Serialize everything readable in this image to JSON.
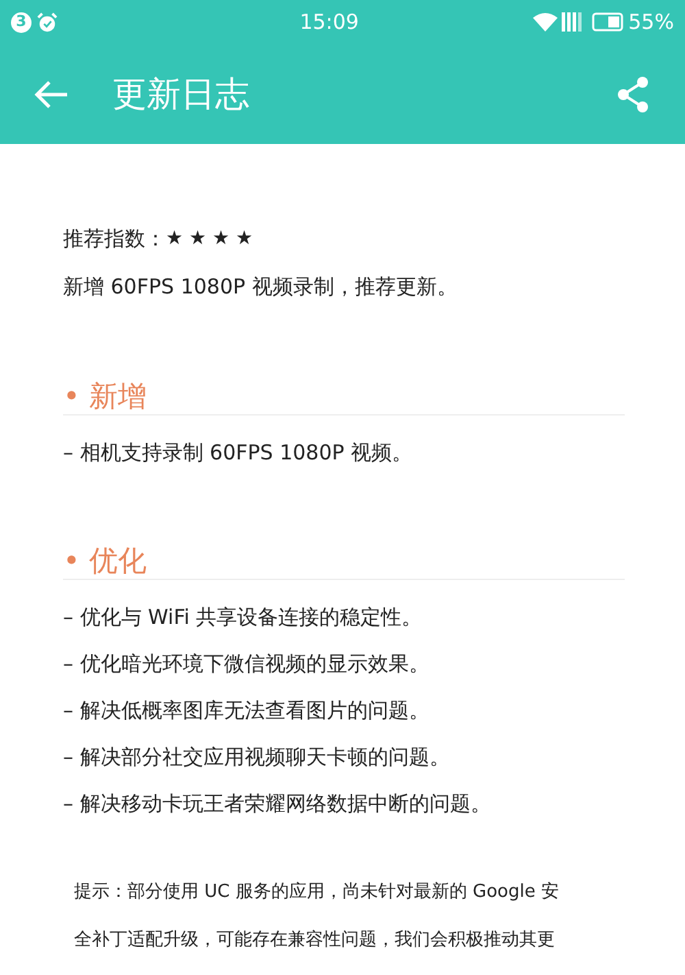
{
  "status_bar": {
    "notification_count": "3",
    "time": "15:09",
    "battery": "55%"
  },
  "header": {
    "title": "更新日志"
  },
  "summary": {
    "rating_label": "推荐指数：",
    "rating": "★ ★ ★ ★",
    "text": "新增 60FPS 1080P 视频录制，推荐更新。"
  },
  "sections": [
    {
      "title": "• 新增",
      "items": [
        "– 相机支持录制 60FPS 1080P 视频。"
      ]
    },
    {
      "title": "• 优化",
      "items": [
        "– 优化与 WiFi 共享设备连接的稳定性。",
        "– 优化暗光环境下微信视频的显示效果。",
        "– 解决低概率图库无法查看图片的问题。",
        "– 解决部分社交应用视频聊天卡顿的问题。",
        "– 解决移动卡玩王者荣耀网络数据中断的问题。"
      ]
    }
  ],
  "note_lines": [
    "提示：部分使用 UC 服务的应用，尚未针对最新的 Google 安",
    "全补丁适配升级，可能存在兼容性问题，我们会积极推动其更"
  ]
}
